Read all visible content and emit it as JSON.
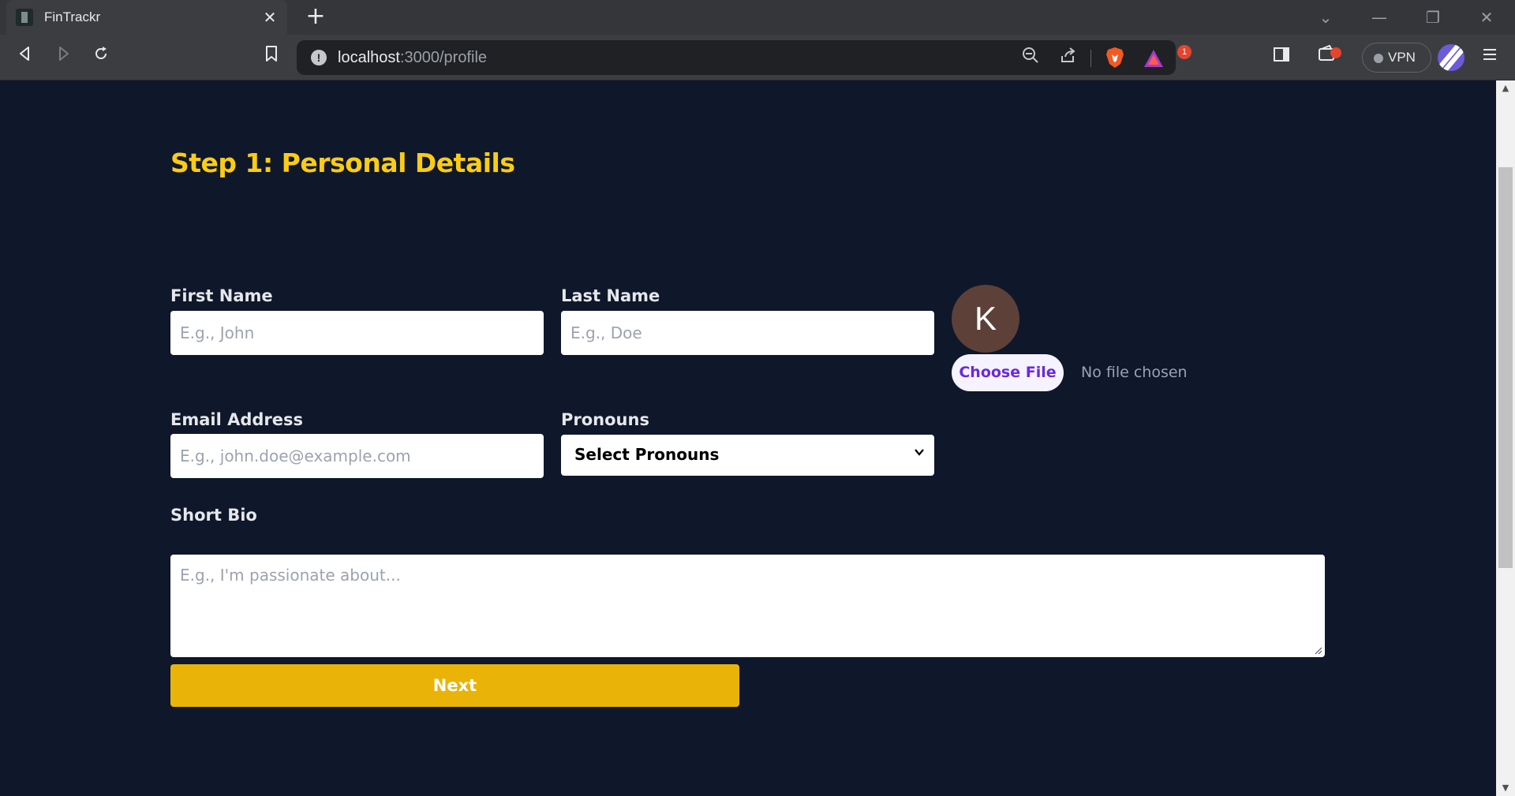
{
  "browser": {
    "tab_title": "FinTrackr",
    "tab_close": "✕",
    "new_tab": "+",
    "url_host": "localhost",
    "url_path": ":3000/profile",
    "rewards_badge": "1",
    "vpn_label": "VPN"
  },
  "form": {
    "heading": "Step 1: Personal Details",
    "first_name": {
      "label": "First Name",
      "placeholder": "E.g., John"
    },
    "last_name": {
      "label": "Last Name",
      "placeholder": "E.g., Doe"
    },
    "email": {
      "label": "Email Address",
      "placeholder": "E.g., john.doe@example.com"
    },
    "pronouns": {
      "label": "Pronouns",
      "selected": "Select Pronouns"
    },
    "bio": {
      "label": "Short Bio",
      "placeholder": "E.g., I'm passionate about..."
    },
    "avatar_initial": "K",
    "choose_file": "Choose File",
    "no_file": "No file chosen",
    "next": "Next"
  },
  "colors": {
    "page_bg": "#0f172a",
    "heading": "#facc15",
    "next_button": "#eab308",
    "avatar_bg": "#5d4037",
    "choose_file_text": "#6d28d9"
  }
}
